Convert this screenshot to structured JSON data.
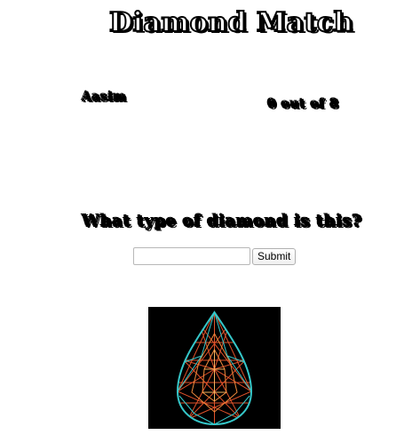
{
  "header": {
    "title": "Diamond Match"
  },
  "player": {
    "name": "Aasim"
  },
  "score": {
    "text": "0 out of 8",
    "correct": 0,
    "total": 8
  },
  "quiz": {
    "question": "What type of diamond is this?",
    "answer_value": "",
    "answer_placeholder": "",
    "submit_label": "Submit"
  },
  "diamond_image": {
    "icon": "pear-diamond-icon",
    "colors": {
      "background": "#000000",
      "outline": "#35c7c9",
      "facets": "#e0522a",
      "highlight": "#f08a3c"
    }
  }
}
